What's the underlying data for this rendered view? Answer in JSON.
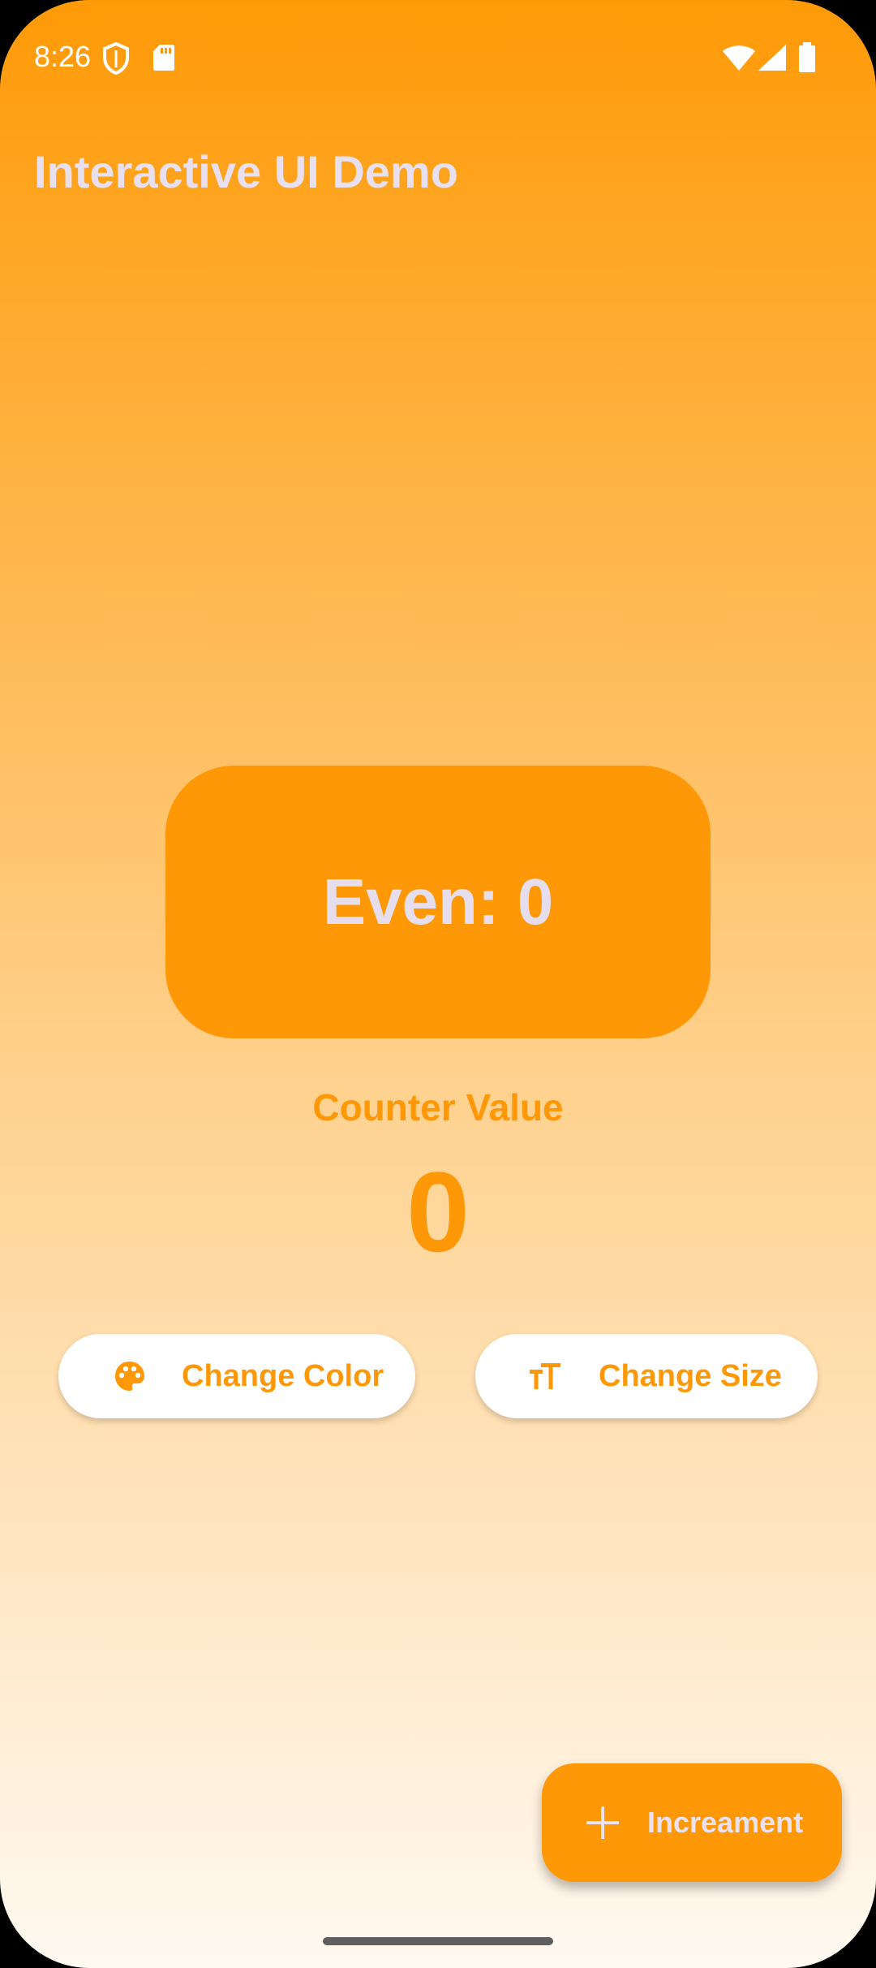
{
  "status_bar": {
    "time": "8:26",
    "left_icons": [
      "shield-icon",
      "sd-card-icon"
    ],
    "right_icons": [
      "wifi-icon",
      "cell-signal-icon",
      "battery-icon"
    ]
  },
  "app_bar": {
    "title": "Interactive UI Demo"
  },
  "parity_card": {
    "text": "Even: 0",
    "background": "#FF9806"
  },
  "counter": {
    "label": "Counter Value",
    "value": "0"
  },
  "actions": {
    "change_color": {
      "icon": "palette-icon",
      "label": "Change Color"
    },
    "change_size": {
      "icon": "text-size-icon",
      "label": "Change Size"
    }
  },
  "fab": {
    "icon": "plus-icon",
    "label": "Increament"
  },
  "colors": {
    "accent": "#FF9806",
    "gradient_top": "#FF9A07",
    "gradient_bottom": "#FFF9F1",
    "light_text": "#E8E0EE"
  }
}
